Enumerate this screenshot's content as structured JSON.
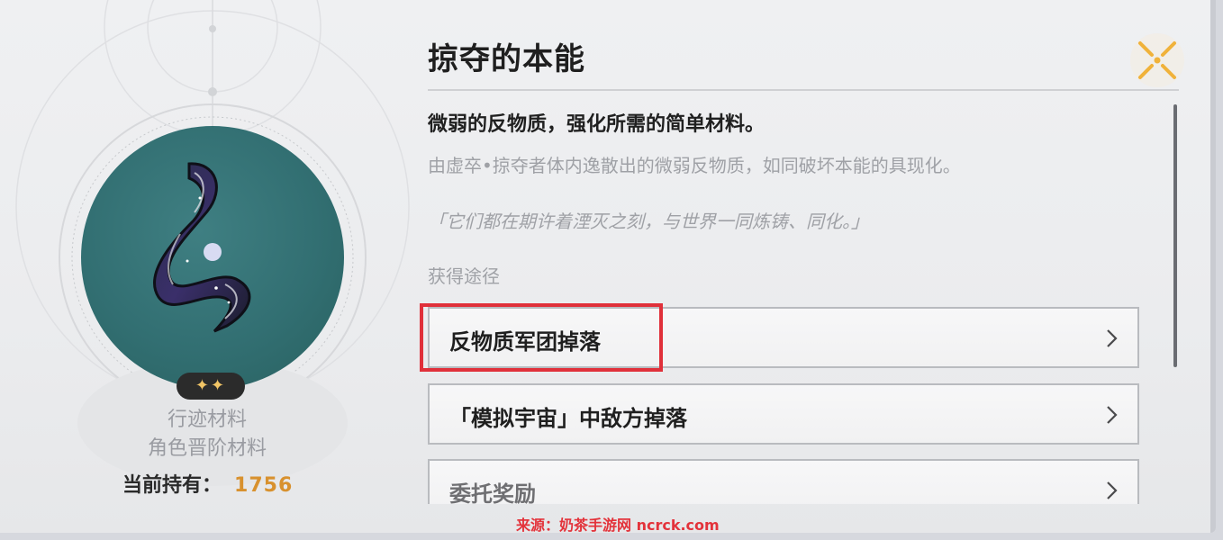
{
  "item": {
    "name": "掠夺的本能",
    "rarity_stars": "✦✦",
    "type_primary": "行迹材料",
    "type_secondary": "角色晋阶材料",
    "owned_label": "当前持有：",
    "owned_count": "1756",
    "icon": "antimatter-ribbon-icon"
  },
  "description": {
    "summary": "微弱的反物质，强化所需的简单材料。",
    "detail": "由虚卒•掠夺者体内逸散出的微弱反物质，如同破坏本能的具现化。",
    "quote": "「它们都在期许着湮灭之刻，与世界一同炼铸、同化。」"
  },
  "sources": {
    "label": "获得途径",
    "items": [
      {
        "label": "反物质军团掉落"
      },
      {
        "label": "「模拟宇宙」中敌方掉落"
      },
      {
        "label": "委托奖励"
      }
    ]
  },
  "controls": {
    "close_icon": "close-x-icon",
    "chevron_icon": "chevron-right-icon"
  },
  "watermark": "来源：奶茶手游网 ncrck.com",
  "colors": {
    "accent_gold": "#d8912e",
    "close_orange": "#f0b23a",
    "highlight_red": "#e0303a",
    "item_bg_teal": "#326f72"
  }
}
